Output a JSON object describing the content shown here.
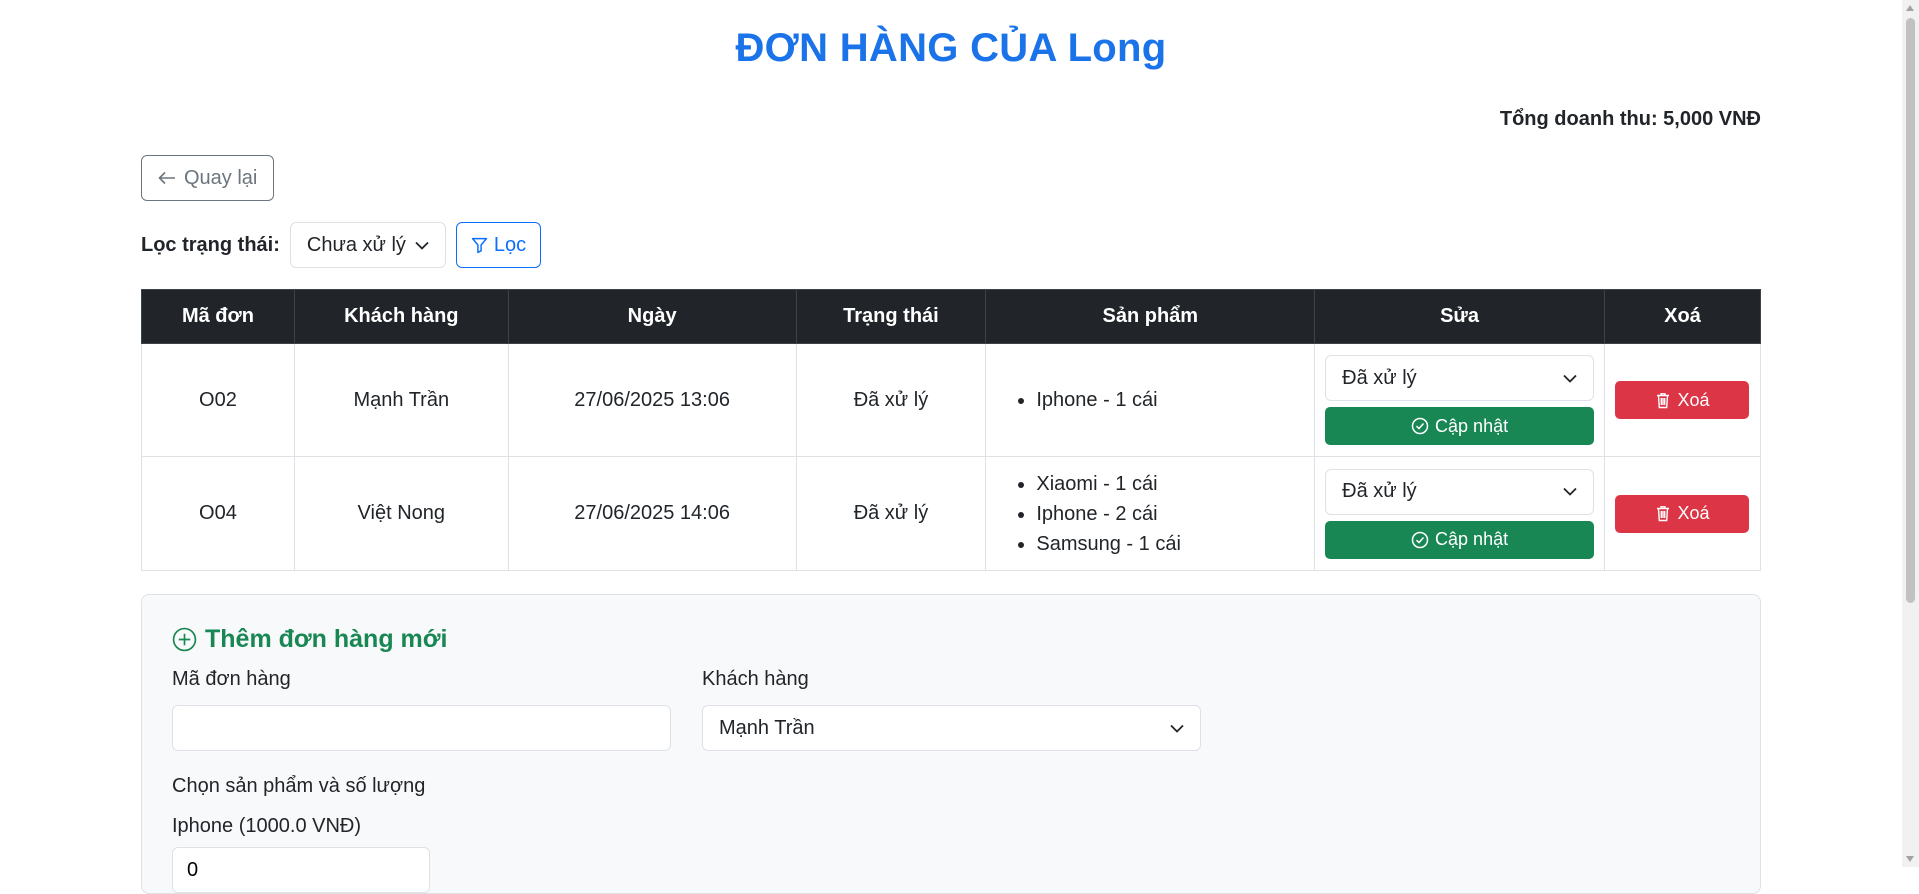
{
  "page": {
    "title": "ĐƠN HÀNG CỦA Long",
    "revenue": "Tổng doanh thu: 5,000 VNĐ"
  },
  "toolbar": {
    "back_label": "Quay lại",
    "filter_label": "Lọc trạng thái:",
    "filter_value": "Chưa xử lý",
    "filter_button": "Lọc"
  },
  "table": {
    "headers": [
      "Mã đơn",
      "Khách hàng",
      "Ngày",
      "Trạng thái",
      "Sản phẩm",
      "Sửa",
      "Xoá"
    ],
    "rows": [
      {
        "id": "O02",
        "customer": "Mạnh Trần",
        "date": "27/06/2025 13:06",
        "status": "Đã xử lý",
        "products": [
          "Iphone - 1 cái"
        ],
        "edit_status": "Đã xử lý",
        "update_label": "Cập nhật",
        "delete_label": "Xoá"
      },
      {
        "id": "O04",
        "customer": "Việt Nong",
        "date": "27/06/2025 14:06",
        "status": "Đã xử lý",
        "products": [
          "Xiaomi - 1 cái",
          "Iphone - 2 cái",
          "Samsung - 1 cái"
        ],
        "edit_status": "Đã xử lý",
        "update_label": "Cập nhật",
        "delete_label": "Xoá"
      }
    ]
  },
  "new_order": {
    "title": "Thêm đơn hàng mới",
    "order_id_label": "Mã đơn hàng",
    "order_id_value": "",
    "customer_label": "Khách hàng",
    "customer_value": "Mạnh Trần",
    "products_label": "Chọn sản phẩm và số lượng",
    "product_1_label": "Iphone (1000.0 VNĐ)",
    "product_1_qty": "0"
  },
  "colors": {
    "title": "#1a73e8",
    "header_bg": "#212529",
    "update": "#198754",
    "delete": "#dc3545",
    "filter": "#0d6efd",
    "new_title": "#198754"
  }
}
